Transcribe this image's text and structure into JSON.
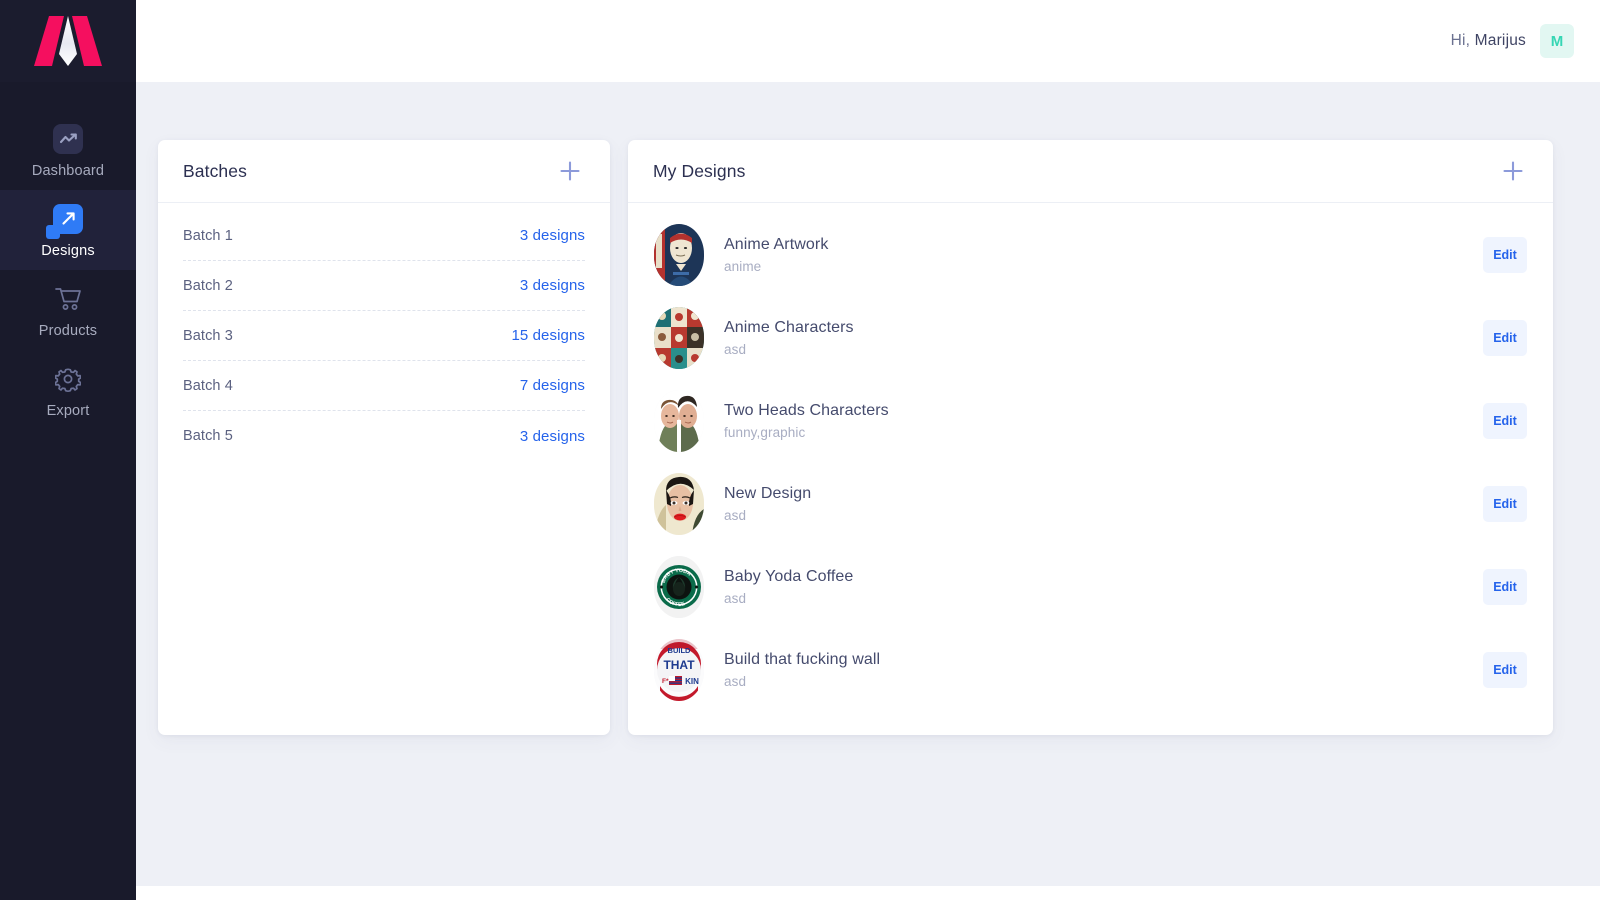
{
  "brand": {
    "logo_icon": "m-logo-icon",
    "logo_colors": {
      "wing": "#f50f5f",
      "center": "#ffffff"
    }
  },
  "sidebar": {
    "background": "#191a2b",
    "items": [
      {
        "label": "Dashboard",
        "icon": "trend-chart-icon",
        "active": false
      },
      {
        "label": "Designs",
        "icon": "arrow-expand-icon",
        "active": true
      },
      {
        "label": "Products",
        "icon": "shopping-cart-icon",
        "active": false
      },
      {
        "label": "Export",
        "icon": "gear-icon",
        "active": false
      }
    ]
  },
  "topbar": {
    "greeting_prefix": "Hi,",
    "user_name": "Marijus",
    "avatar_initial": "M",
    "avatar_bg": "#e2f7f2",
    "avatar_color": "#36d6b4"
  },
  "batches_panel": {
    "title": "Batches",
    "add_icon": "plus-icon",
    "rows": [
      {
        "name": "Batch 1",
        "count": "3 designs"
      },
      {
        "name": "Batch 2",
        "count": "3 designs"
      },
      {
        "name": "Batch 3",
        "count": "15 designs"
      },
      {
        "name": "Batch 4",
        "count": "7 designs"
      },
      {
        "name": "Batch 5",
        "count": "3 designs"
      }
    ]
  },
  "designs_panel": {
    "title": "My Designs",
    "add_icon": "plus-icon",
    "edit_label": "Edit",
    "rows": [
      {
        "name": "Anime Artwork",
        "tags": "anime",
        "thumb": "saitama-portrait-thumb"
      },
      {
        "name": "Anime Characters",
        "tags": "asd",
        "thumb": "anime-collage-thumb"
      },
      {
        "name": "Two Heads Characters",
        "tags": "funny,graphic",
        "thumb": "two-heads-thumb"
      },
      {
        "name": "New Design",
        "tags": "asd",
        "thumb": "face-redlips-thumb"
      },
      {
        "name": "Baby Yoda Coffee",
        "tags": "asd",
        "thumb": "baby-yoda-coffee-thumb"
      },
      {
        "name": "Build that fucking wall",
        "tags": "asd",
        "thumb": "build-that-wall-thumb"
      }
    ]
  },
  "colors": {
    "page_bg": "#eef0f6",
    "accent_blue": "#2563eb",
    "plus_icon": "#8c9ada",
    "title_text": "#2c3051"
  }
}
